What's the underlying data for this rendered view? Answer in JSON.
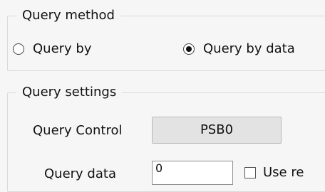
{
  "query_method": {
    "title": "Query method",
    "options": [
      {
        "label": "Query by",
        "checked": false
      },
      {
        "label": "Query by data",
        "checked": true
      }
    ]
  },
  "query_settings": {
    "title": "Query settings",
    "query_control_label": "Query Control",
    "query_control_value": "PSB0",
    "query_data_label": "Query data",
    "query_data_value": "0",
    "use_checkbox_label": "Use re"
  },
  "icons": {
    "radio_unchecked": "radio-unchecked-icon",
    "radio_checked": "radio-checked-icon",
    "checkbox_unchecked": "checkbox-unchecked-icon"
  }
}
